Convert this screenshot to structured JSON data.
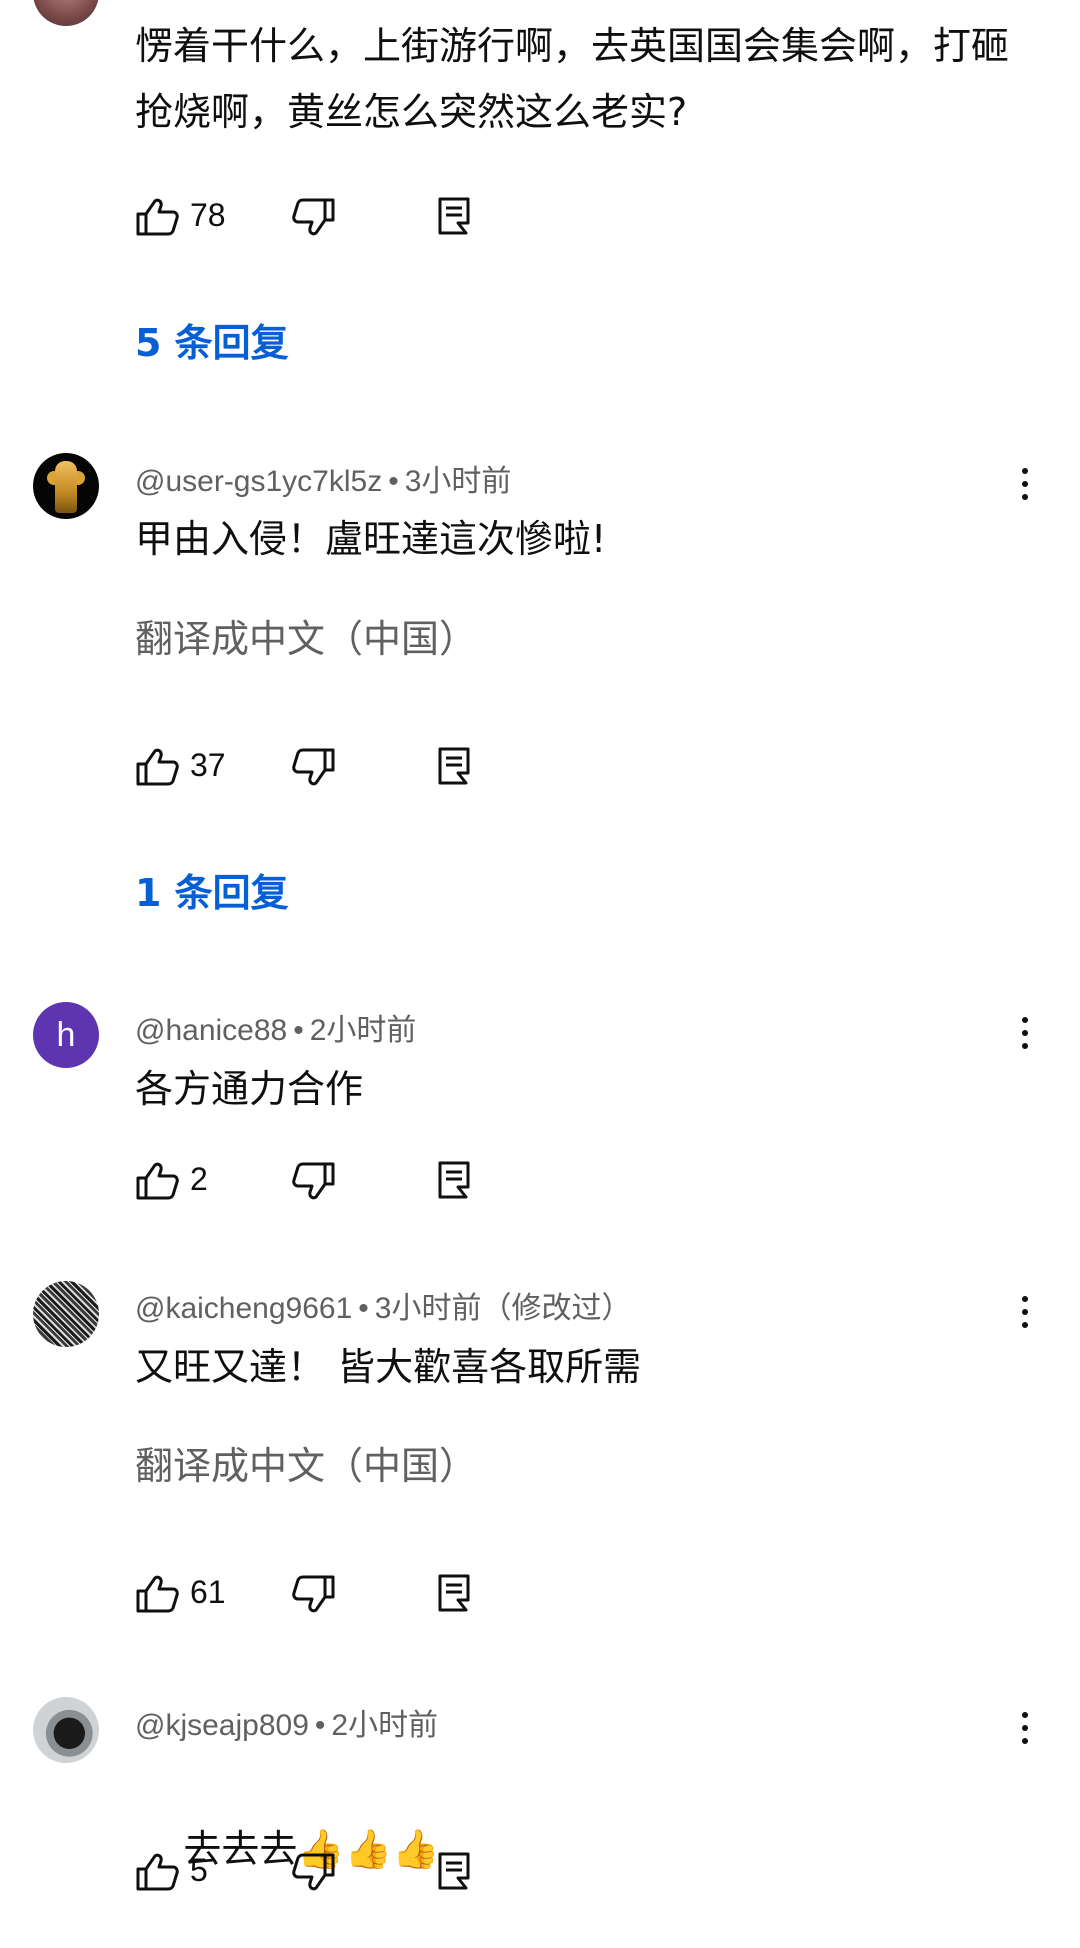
{
  "top_comment": {
    "text": "愣着干什么，上街游行啊，去英国国会集会啊，打砸抢烧啊，黄丝怎么突然这么老实?",
    "likes": "78",
    "replies_label": "5 条回复"
  },
  "comments": [
    {
      "handle": "@user-gs1yc7kl5z",
      "time": "3小时前",
      "edited": "",
      "text": "甲由入侵！盧旺達這次慘啦!",
      "translate": "翻译成中文（中国）",
      "likes": "37",
      "replies_label": "1 条回复"
    },
    {
      "handle": "@hanice88",
      "time": "2小时前",
      "avatar_letter": "h",
      "text": "各方通力合作",
      "likes": "2"
    },
    {
      "handle": "@kaicheng9661",
      "time": "3小时前（修改过）",
      "text": "又旺又達！ 皆大歡喜各取所需",
      "translate": "翻译成中文（中国）",
      "likes": "61"
    },
    {
      "handle": "@kjseajp809",
      "time": "2小时前",
      "text": "去去去",
      "emoji": "👍👍👍",
      "likes": "5"
    }
  ],
  "separator": "•",
  "icons": {
    "like": "thumb-up-icon",
    "dislike": "thumb-down-icon",
    "reply": "reply-icon",
    "more": "more-vertical-icon"
  },
  "colors": {
    "link": "#065fd4",
    "meta": "#606060",
    "text": "#0f0f0f"
  }
}
